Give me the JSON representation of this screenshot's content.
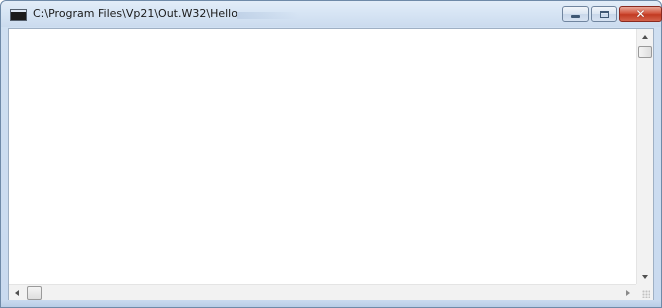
{
  "window": {
    "title": "C:\\Program Files\\Vp21\\Out.W32\\Hello",
    "buttons": {
      "minimize": "minimize",
      "maximize": "maximize",
      "close": "close"
    }
  },
  "icons": {
    "app": "console-app-icon",
    "minimize": "minimize-icon",
    "maximize": "maximize-icon",
    "close": "close-icon",
    "scroll_up": "arrow-up-icon",
    "scroll_down": "arrow-down-icon",
    "scroll_left": "arrow-left-icon",
    "scroll_right": "arrow-right-icon"
  },
  "colors": {
    "frame": "#cfdff1",
    "close_button": "#c23a22",
    "client_background": "#ffffff"
  },
  "client": {
    "text": ""
  },
  "scroll": {
    "vertical_position": 0,
    "horizontal_position": 0
  }
}
